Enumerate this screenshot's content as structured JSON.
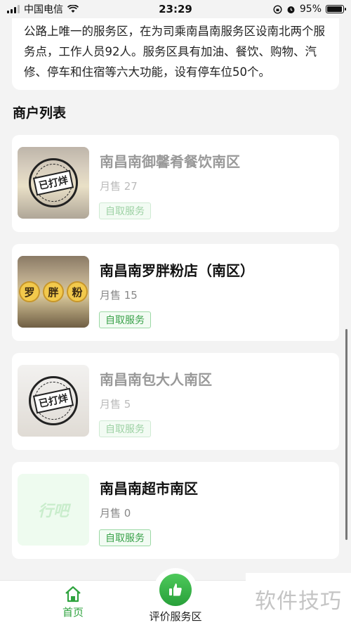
{
  "status_bar": {
    "carrier": "中国电信",
    "time": "23:29",
    "battery": "95%",
    "battery_level": 0.95
  },
  "description": {
    "text": "公路上唯一的服务区，在为司乘南昌南服务区设南北两个服务点，工作人员92人。服务区具有加油、餐饮、购物、汽修、停车和住宿等六大功能，设有停车位50个。"
  },
  "section": {
    "title": "商户列表"
  },
  "merchants": [
    {
      "name": "南昌南御馨肴餐饮南区",
      "sales": "月售 27",
      "tag": "自取服务",
      "status": "已打烊"
    },
    {
      "name": "南昌南罗胖粉店（南区）",
      "sales": "月售 15",
      "tag": "自取服务",
      "sign": [
        "罗",
        "胖",
        "粉"
      ]
    },
    {
      "name": "南昌南包大人南区",
      "sales": "月售 5",
      "tag": "自取服务",
      "status": "已打烊"
    },
    {
      "name": "南昌南超市南区",
      "sales": "月售 0",
      "tag": "自取服务",
      "placeholder": "行吧"
    }
  ],
  "tab_bar": {
    "home_label": "首页",
    "review_label": "评价服务区"
  },
  "watermark": "软件技巧",
  "colors": {
    "accent": "#2fa33f",
    "background": "#f3f3f3"
  }
}
